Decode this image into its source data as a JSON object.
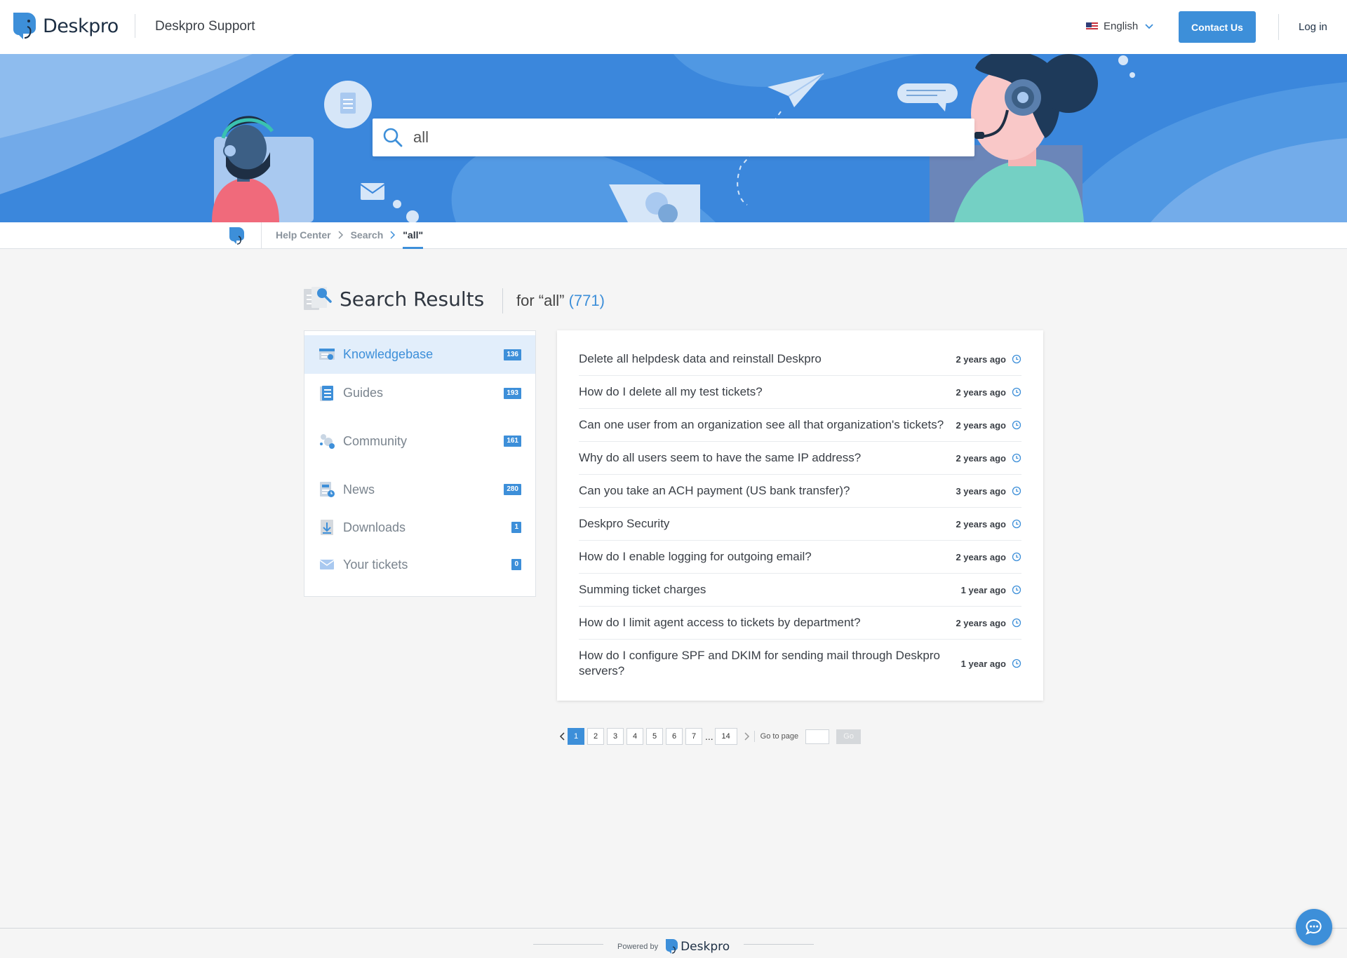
{
  "header": {
    "logo_text": "Deskpro",
    "site_name": "Deskpro Support",
    "language": "English",
    "contact_label": "Contact Us",
    "login_label": "Log in"
  },
  "search": {
    "value": "all"
  },
  "breadcrumb": {
    "items": [
      "Help Center",
      "Search",
      "\"all\""
    ]
  },
  "results_header": {
    "title": "Search Results",
    "for_text": "for “all”",
    "count": "(771)"
  },
  "sidebar": {
    "items": [
      {
        "label": "Knowledgebase",
        "count": "136",
        "icon": "knowledgebase-icon"
      },
      {
        "label": "Guides",
        "count": "193",
        "icon": "guides-icon"
      },
      {
        "label": "Community",
        "count": "161",
        "icon": "community-icon"
      },
      {
        "label": "News",
        "count": "280",
        "icon": "news-icon"
      },
      {
        "label": "Downloads",
        "count": "1",
        "icon": "downloads-icon"
      },
      {
        "label": "Your tickets",
        "count": "0",
        "icon": "envelope-icon"
      }
    ]
  },
  "results": [
    {
      "title": "Delete all helpdesk data and reinstall Deskpro",
      "time": "2 years ago"
    },
    {
      "title": "How do I delete all my test tickets?",
      "time": "2 years ago"
    },
    {
      "title": "Can one user from an organization see all that organization's tickets?",
      "time": "2 years ago"
    },
    {
      "title": "Why do all users seem to have the same IP address?",
      "time": "2 years ago"
    },
    {
      "title": "Can you take an ACH payment (US bank transfer)?",
      "time": "3 years ago"
    },
    {
      "title": "Deskpro Security",
      "time": "2 years ago"
    },
    {
      "title": "How do I enable logging for outgoing email?",
      "time": "2 years ago"
    },
    {
      "title": "Summing ticket charges",
      "time": "1 year ago"
    },
    {
      "title": "How do I limit agent access to tickets by department?",
      "time": "2 years ago"
    },
    {
      "title": "How do I configure SPF and DKIM for sending mail through Deskpro servers?",
      "time": "1 year ago"
    }
  ],
  "pagination": {
    "pages": [
      "1",
      "2",
      "3",
      "4",
      "5",
      "6",
      "7"
    ],
    "ellipsis": "...",
    "last_page": "14",
    "current": "1",
    "goto_label": "Go to page",
    "go_label": "Go"
  },
  "footer": {
    "powered_by": "Powered by",
    "brand": "Deskpro"
  },
  "colors": {
    "accent": "#3d8fd9",
    "hero_bg": "#3b87dc"
  }
}
